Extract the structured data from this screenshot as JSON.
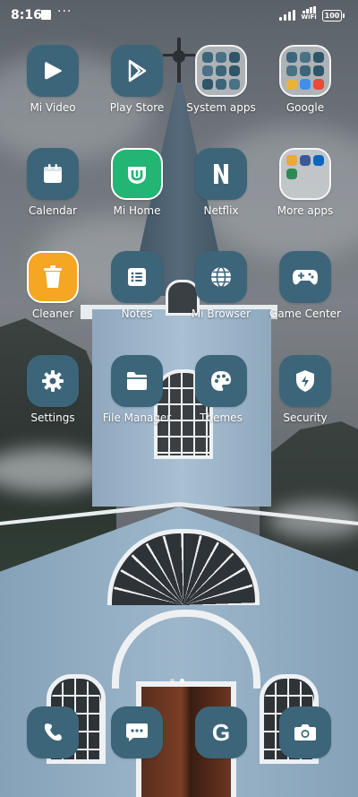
{
  "status_bar": {
    "time": "8:16",
    "notification_more": "···",
    "wifi_label": "WiFi",
    "battery": "100"
  },
  "apps": [
    {
      "label": "Mi Video",
      "icon": "play-icon"
    },
    {
      "label": "Play Store",
      "icon": "play-store-icon"
    },
    {
      "label": "System apps",
      "icon": "folder-icon"
    },
    {
      "label": "Google",
      "icon": "folder-icon"
    },
    {
      "label": "Calendar",
      "icon": "calendar-icon"
    },
    {
      "label": "Mi Home",
      "icon": "mi-home-icon"
    },
    {
      "label": "Netflix",
      "icon": "netflix-icon"
    },
    {
      "label": "More apps",
      "icon": "folder-icon"
    },
    {
      "label": "Cleaner",
      "icon": "trash-icon"
    },
    {
      "label": "Notes",
      "icon": "notes-icon"
    },
    {
      "label": "Mi Browser",
      "icon": "globe-icon"
    },
    {
      "label": "Game Center",
      "icon": "gamepad-icon"
    },
    {
      "label": "Settings",
      "icon": "gear-icon"
    },
    {
      "label": "File Manager",
      "icon": "folder-open-icon"
    },
    {
      "label": "Themes",
      "icon": "palette-icon"
    },
    {
      "label": "Security",
      "icon": "shield-icon"
    }
  ],
  "dock": [
    {
      "name": "phone",
      "icon": "phone-icon"
    },
    {
      "name": "messages",
      "icon": "message-icon"
    },
    {
      "name": "google",
      "icon": "google-g-icon",
      "glyph": "G"
    },
    {
      "name": "camera",
      "icon": "camera-icon"
    }
  ],
  "pager": {
    "pages": 2,
    "current": 2
  },
  "colors": {
    "tile": "#3d6579",
    "cleaner": "#f5a623",
    "mi_home": "#22b573"
  }
}
